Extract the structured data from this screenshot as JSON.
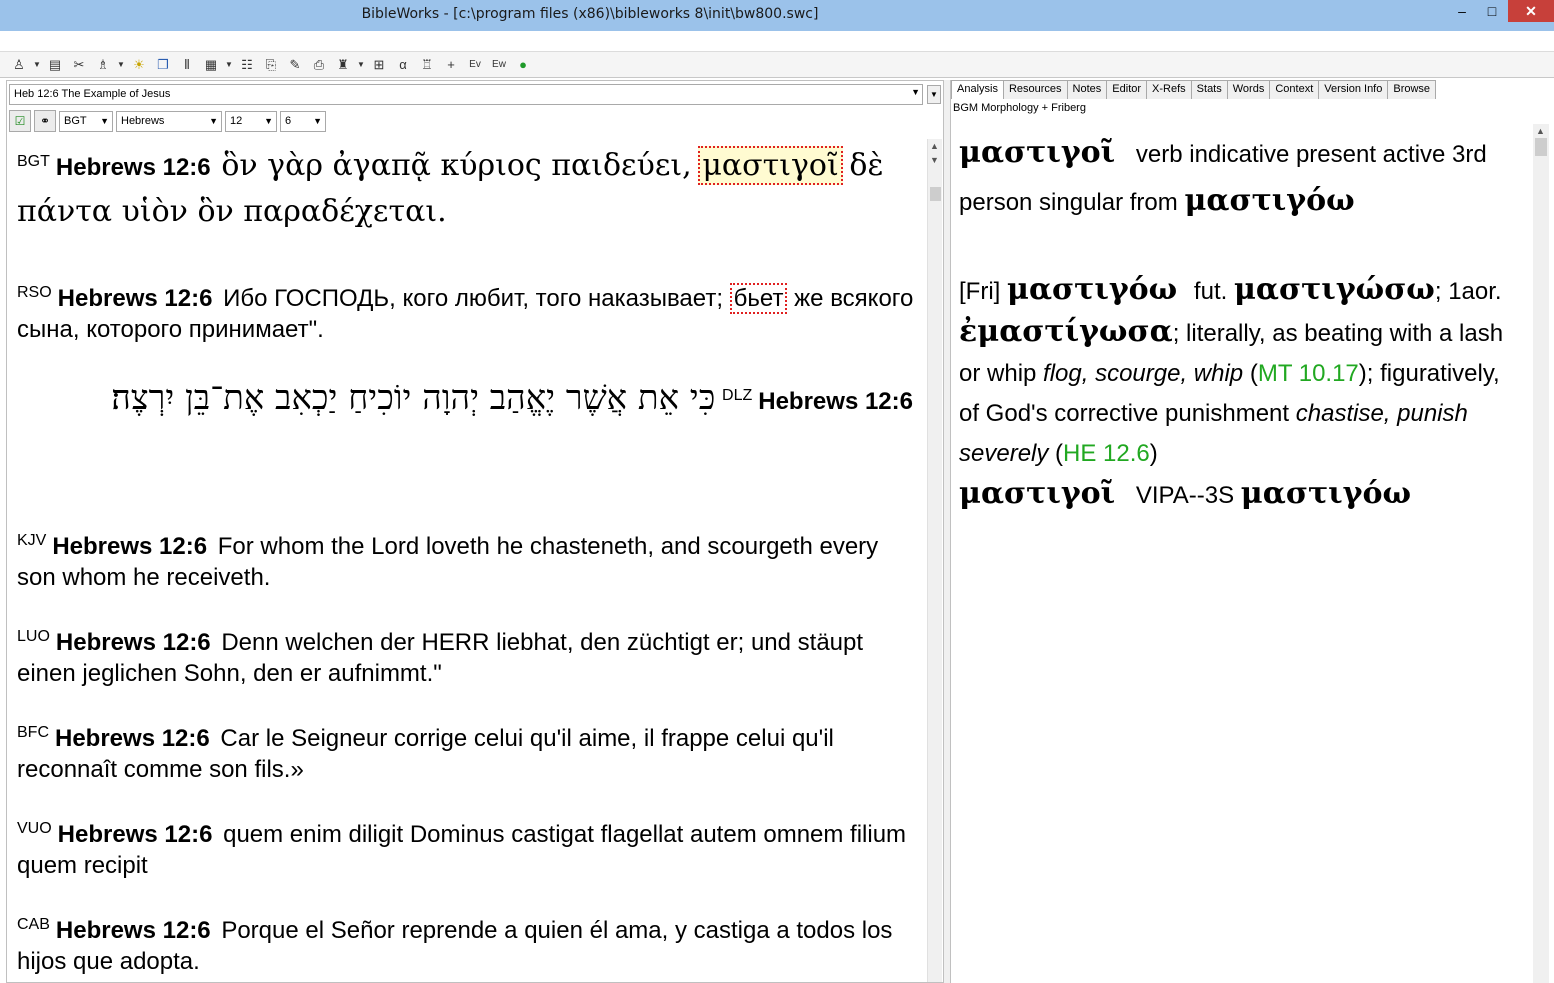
{
  "window": {
    "title": "BibleWorks - [c:\\program files (x86)\\bibleworks 8\\init\\bw800.swc]",
    "min": "–",
    "max": "□",
    "close": "✕"
  },
  "toolbar": {
    "icons": [
      "search-icon",
      "browse-icon",
      "tools-icon",
      "person-icon",
      "lamp-icon",
      "window-icon",
      "parallel-icon",
      "grid-icon",
      "list-icon",
      "copy-icon",
      "edit-icon",
      "print-icon",
      "morph-icon",
      "layout-icon",
      "alpha-icon",
      "reader-icon",
      "plus-icon",
      "ev-icon",
      "ew-icon",
      "globe-icon"
    ]
  },
  "left": {
    "reference": "Heb 12:6 The Example of Jesus",
    "version_select": "BGT",
    "book_select": "Hebrews",
    "chapter_select": "12",
    "verse_select": "6",
    "verses": [
      {
        "abbr": "BGT",
        "ref": "Hebrews 12:6",
        "pre": "ὃν γὰρ ἀγαπᾷ κύριος παιδεύει,",
        "hl": "μαστιγοῖ",
        "post": "δὲ πάντα υἱὸν ὃν παραδέχεται."
      },
      {
        "abbr": "RSO",
        "ref": "Hebrews 12:6",
        "pre": "Ибо ГОСПОДЬ, кого любит, того наказывает;",
        "hl": "бьет",
        "post": "же всякого сына, которого принимает\"."
      },
      {
        "abbr": "DLZ",
        "ref": "Hebrews 12:6",
        "text": "כִּי אֵת אֲשֶׁר יֶאֱהַב יְהוָה יוֹכִיחַ יַכְאִב אֶת־בֵּן יִרְצֶה׃"
      },
      {
        "abbr": "KJV",
        "ref": "Hebrews 12:6",
        "text": "For whom the Lord loveth he chasteneth, and scourgeth every son whom he receiveth."
      },
      {
        "abbr": "LUO",
        "ref": "Hebrews 12:6",
        "text": "Denn welchen der HERR liebhat, den züchtigt er; und stäupt einen jeglichen Sohn, den er aufnimmt.\""
      },
      {
        "abbr": "BFC",
        "ref": "Hebrews 12:6",
        "text": "Car le Seigneur corrige celui qu'il aime, il frappe celui qu'il reconnaît comme son fils.»"
      },
      {
        "abbr": "VUO",
        "ref": "Hebrews 12:6",
        "text": "quem enim diligit Dominus castigat flagellat autem omnem filium quem recipit"
      },
      {
        "abbr": "CAB",
        "ref": "Hebrews 12:6",
        "text": "Porque el Señor reprende a quien él ama, y castiga a todos los hijos que adopta."
      }
    ]
  },
  "right": {
    "tabs": [
      "Analysis",
      "Resources",
      "Notes",
      "Editor",
      "X-Refs",
      "Stats",
      "Words",
      "Context",
      "Version Info",
      "Browse"
    ],
    "label": "BGM Morphology + Friberg",
    "analysis": {
      "word": "μαστιγοῖ",
      "parse": "verb indicative present active 3rd person singular from",
      "lemma": "μαστιγόω",
      "fri_tag": "[Fri]",
      "fri_lemma": "μαστιγόω",
      "fut_label": "fut.",
      "fut_form": "μαστιγώσω",
      "aor_label": "; 1aor.",
      "aor_form": "ἐμαστίγωσα",
      "def1": "; literally, as beating with a lash or whip",
      "def1_gloss": "flog, scourge, whip",
      "ref1": "MT 10.17",
      "def2": "; figuratively, of God's corrective punishment",
      "def2_gloss": "chastise, punish severely",
      "ref2": "HE 12.6",
      "word2": "μαστιγοῖ",
      "code": "VIPA--3S",
      "lemma2": "μαστιγόω"
    }
  }
}
